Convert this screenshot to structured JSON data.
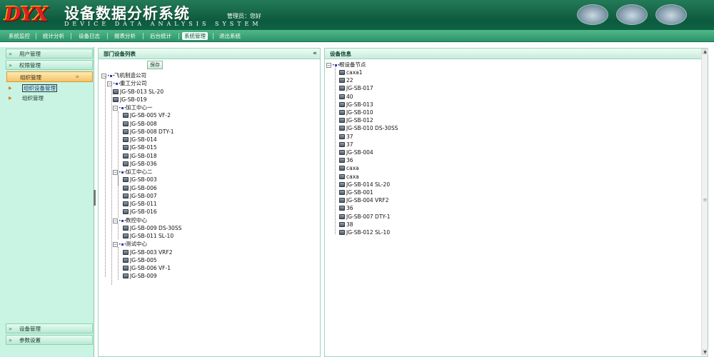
{
  "header": {
    "logo": "DYX",
    "title_cn": "设备数据分析系统",
    "title_en": "DEVICE DATA ANALYSIS SYSTEM",
    "admin": "管理员：您好"
  },
  "nav": [
    "系统监控",
    "统计分析",
    "设备日志",
    "报表分析",
    "后台统计",
    "系统管理",
    "退出系统"
  ],
  "nav_active": "系统管理",
  "sidebar": {
    "top": [
      "用户管理",
      "权限管理"
    ],
    "active": "组织管理",
    "sub": [
      "组织设备管理",
      "组织管理"
    ],
    "bottom": [
      "设备管理",
      "参数设置"
    ]
  },
  "left_panel": {
    "title": "部门设备列表",
    "save_label": "保存",
    "tree": [
      {
        "label": "飞机制造公司",
        "level": 0,
        "type": "group"
      },
      {
        "label": "重工分公司",
        "level": 1,
        "type": "group"
      },
      {
        "label": "JG-SB-013 SL-20",
        "level": 2,
        "type": "device"
      },
      {
        "label": "JG-SB-019",
        "level": 2,
        "type": "device"
      },
      {
        "label": "加工中心一",
        "level": 2,
        "type": "group"
      },
      {
        "label": "JG-SB-005 VF-2",
        "level": 3,
        "type": "device"
      },
      {
        "label": "JG-SB-008",
        "level": 3,
        "type": "device"
      },
      {
        "label": "JG-SB-008 DTY-1",
        "level": 3,
        "type": "device"
      },
      {
        "label": "JG-SB-014",
        "level": 3,
        "type": "device"
      },
      {
        "label": "JG-SB-015",
        "level": 3,
        "type": "device"
      },
      {
        "label": "JG-SB-018",
        "level": 3,
        "type": "device"
      },
      {
        "label": "JG-SB-036",
        "level": 3,
        "type": "device"
      },
      {
        "label": "加工中心二",
        "level": 2,
        "type": "group"
      },
      {
        "label": "JG-SB-003",
        "level": 3,
        "type": "device"
      },
      {
        "label": "JG-SB-006",
        "level": 3,
        "type": "device"
      },
      {
        "label": "JG-SB-007",
        "level": 3,
        "type": "device"
      },
      {
        "label": "JG-SB-011",
        "level": 3,
        "type": "device"
      },
      {
        "label": "JG-SB-016",
        "level": 3,
        "type": "device"
      },
      {
        "label": "数控中心",
        "level": 2,
        "type": "group"
      },
      {
        "label": "JG-SB-009 DS-30SS",
        "level": 3,
        "type": "device"
      },
      {
        "label": "JG-SB-011 SL-10",
        "level": 3,
        "type": "device"
      },
      {
        "label": "测试中心",
        "level": 2,
        "type": "group"
      },
      {
        "label": "JG-SB-003 VRF2",
        "level": 3,
        "type": "device"
      },
      {
        "label": "JG-SB-005",
        "level": 3,
        "type": "device"
      },
      {
        "label": "JG-SB-006 VF-1",
        "level": 3,
        "type": "device"
      },
      {
        "label": "JG-SB-009",
        "level": 3,
        "type": "device"
      }
    ]
  },
  "right_panel": {
    "title": "设备信息",
    "root": "根设备节点",
    "items": [
      "caxa1",
      "22",
      "JG-SB-017",
      "40",
      "JG-SB-013",
      "JG-SB-010",
      "JG-SB-012",
      "JG-SB-010 DS-30SS",
      "37",
      "37",
      "JG-SB-004",
      "36",
      "caxa",
      "caxa",
      "JG-SB-014 SL-20",
      "JG-SB-001",
      "JG-SB-004 VRF2",
      "36",
      "JG-SB-007 DTY-1",
      "38",
      "JG-SB-012 SL-10"
    ]
  },
  "colors": {
    "brand": "#0d5a3e",
    "nav": "#2e9469",
    "sidebar": "#c9f3e3",
    "active": "#f3c46a"
  },
  "icons": {
    "collapse": "double-chevron-left-icon",
    "device": "device-icon",
    "group": "org-group-icon",
    "expand": "tree-expand-icon"
  }
}
